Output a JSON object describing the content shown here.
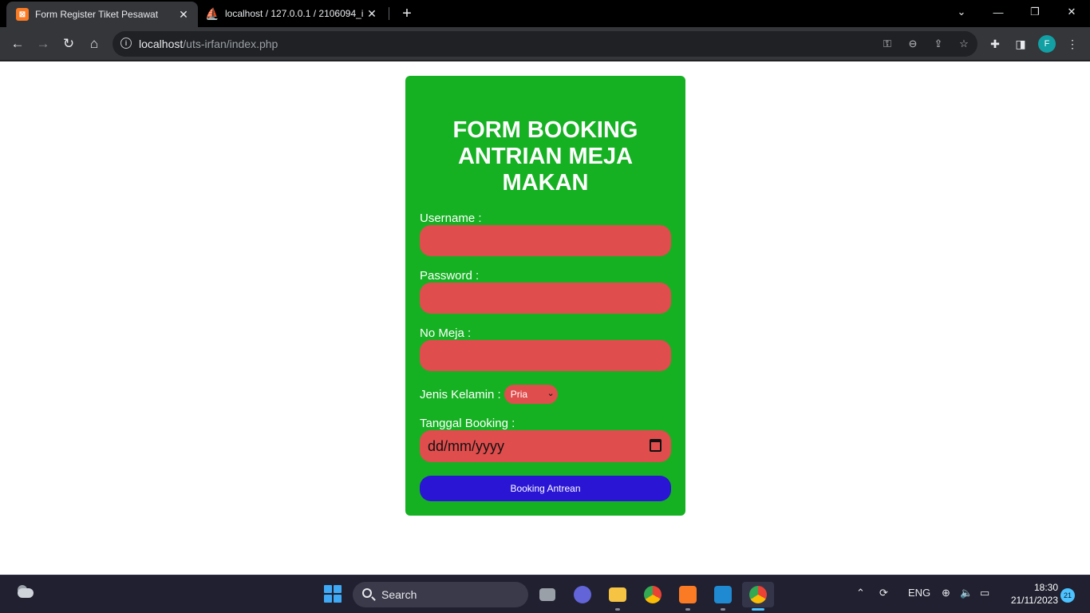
{
  "browser": {
    "tabs": [
      {
        "title": "Form Register Tiket Pesawat",
        "favicon": "xampp-icon",
        "active": true
      },
      {
        "title": "localhost / 127.0.0.1 / 2106094_i",
        "favicon": "phpmyadmin-icon",
        "active": false
      }
    ],
    "url_host": "localhost",
    "url_path": "/uts-irfan/index.php",
    "profile_initial": "F"
  },
  "form": {
    "heading": "FORM BOOKING ANTRIAN MEJA MAKAN",
    "username_label": "Username :",
    "password_label": "Password :",
    "table_label": "No Meja :",
    "gender_label": "Jenis Kelamin :",
    "gender_selected": "Pria",
    "date_label": "Tanggal Booking :",
    "date_placeholder": "dd/mm/yyyy",
    "submit_label": "Booking Antrean"
  },
  "colors": {
    "card": "#15b122",
    "field": "#e04d4d",
    "button": "#2a15d5"
  },
  "taskbar": {
    "search_label": "Search",
    "language": "ENG",
    "time": "18:30",
    "date": "21/11/2023",
    "notification_count": "21"
  }
}
